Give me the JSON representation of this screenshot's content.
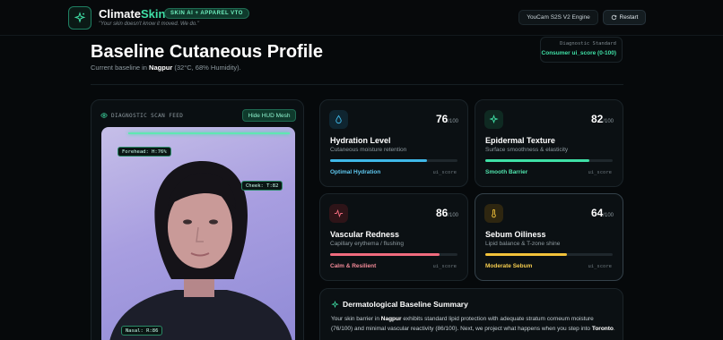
{
  "header": {
    "brand_prefix": "Climate",
    "brand_suffix": "Skin",
    "badge": "SKIN AI + APPAREL VTO",
    "tagline": "\"Your skin doesn't know it moved. We do.\"",
    "engine": "YouCam S2S V2 Engine",
    "restart_label": "Restart"
  },
  "page": {
    "title": "Baseline Cutaneous Profile",
    "subtitle_pre": "Current baseline in ",
    "city": "Nagpur",
    "subtitle_post": " (32°C, 68% Humidity).",
    "diag_label": "Diagnostic Standard",
    "diag_value": "Consumer ui_score (0-100)"
  },
  "scan": {
    "title": "DIAGNOSTIC SCAN FEED",
    "hud_button": "Hide HUD Mesh",
    "tags": {
      "forehead": "Forehead: H:76%",
      "cheek": "Cheek: T:82",
      "nasal": "Nasal: R:86"
    }
  },
  "cards": [
    {
      "name": "Hydration Level",
      "desc": "Cutaneous moisture retention",
      "score": "76",
      "suffix": "/100",
      "level": 0.76,
      "status": "Optimal Hydration",
      "metric": "ui_score",
      "color": "#3fb8e8",
      "status_color": "#5fc8f0"
    },
    {
      "name": "Epidermal Texture",
      "desc": "Surface smoothness & elasticity",
      "score": "82",
      "suffix": "/100",
      "level": 0.82,
      "status": "Smooth Barrier",
      "metric": "ui_score",
      "color": "#3fe0a6",
      "status_color": "#4fe4ad"
    },
    {
      "name": "Vascular Redness",
      "desc": "Capillary erythema / flushing",
      "score": "86",
      "suffix": "/100",
      "level": 0.86,
      "status": "Calm & Resilient",
      "metric": "ui_score",
      "color": "#f06b7e",
      "status_color": "#f48a98"
    },
    {
      "name": "Sebum Oiliness",
      "desc": "Lipid balance & T-zone shine",
      "score": "64",
      "suffix": "/100",
      "level": 0.64,
      "status": "Moderate Sebum",
      "metric": "ui_score",
      "color": "#f2c23a",
      "status_color": "#f5cc4e"
    }
  ],
  "summary": {
    "title": "Dermatological Baseline Summary",
    "t1": "Your skin barrier in ",
    "city": "Nagpur",
    "t2": " exhibits standard lipid protection with adequate stratum corneum moisture (76/100) and minimal vascular reactivity (86/100). Next, we project what happens when you step into ",
    "dest": "Toronto",
    "t3": "."
  }
}
